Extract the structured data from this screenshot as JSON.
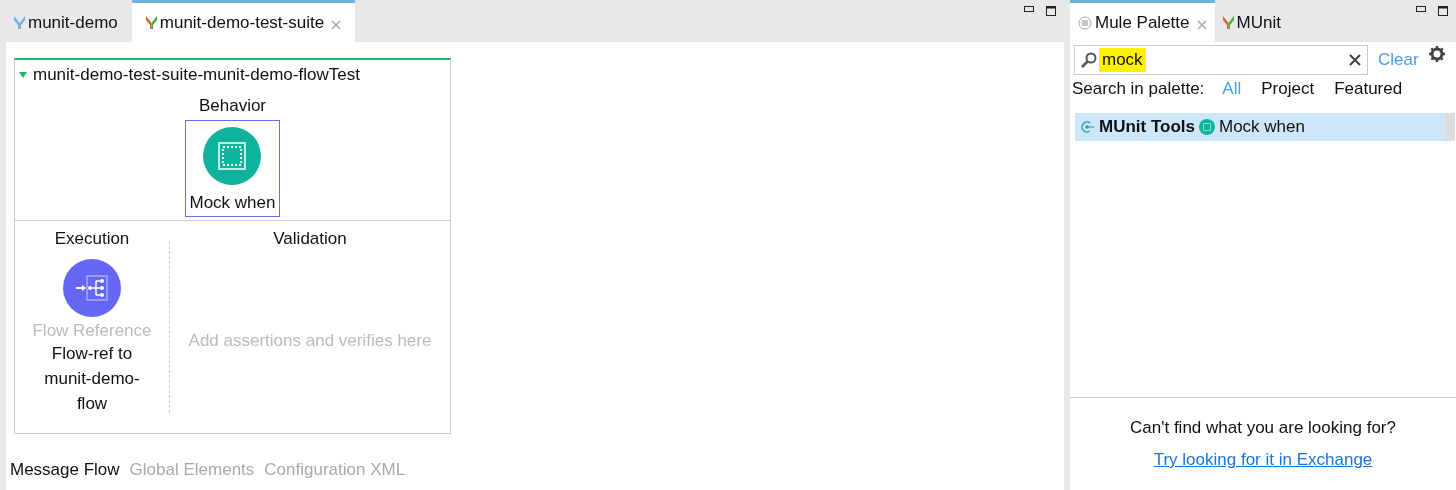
{
  "editor": {
    "tabs": [
      {
        "label": "munit-demo",
        "selected": false,
        "closable": false
      },
      {
        "label": "munit-demo-test-suite",
        "selected": true,
        "closable": true
      }
    ],
    "flow": {
      "title": "munit-demo-test-suite-munit-demo-flowTest",
      "expanded": true,
      "behavior": {
        "heading": "Behavior",
        "processor": {
          "label": "Mock when",
          "selected": true
        }
      },
      "execution": {
        "heading": "Execution",
        "processor": {
          "type_label": "Flow Reference",
          "label": "Flow-ref to munit-demo-flow"
        }
      },
      "validation": {
        "heading": "Validation",
        "hint": "Add assertions and verifies here"
      }
    },
    "bottom_tabs": [
      {
        "label": "Message Flow",
        "selected": true
      },
      {
        "label": "Global Elements",
        "selected": false
      },
      {
        "label": "Configuration XML",
        "selected": false
      }
    ]
  },
  "palette": {
    "tabs": [
      {
        "label": "Mule Palette",
        "selected": true,
        "closable": true
      },
      {
        "label": "MUnit",
        "selected": false,
        "closable": false
      }
    ],
    "search": {
      "value": "mock",
      "highlighted": true
    },
    "clear": "Clear",
    "filter_label": "Search in palette:",
    "filters": [
      {
        "label": "All",
        "selected": true
      },
      {
        "label": "Project",
        "selected": false
      },
      {
        "label": "Featured",
        "selected": false
      }
    ],
    "results": [
      {
        "category": "MUnit Tools",
        "item": "Mock when",
        "selected": true
      }
    ],
    "footer": {
      "message": "Can't find what you are looking for?",
      "link": "Try looking for it in Exchange"
    }
  }
}
